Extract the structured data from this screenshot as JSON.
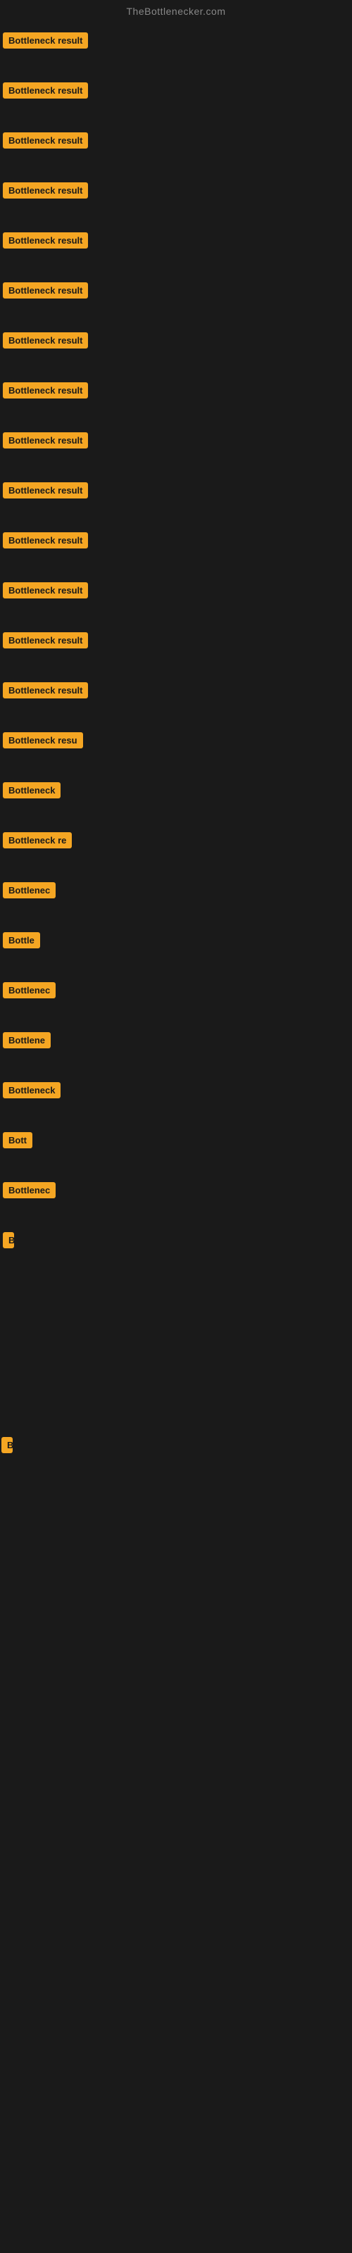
{
  "header": {
    "title": "TheBottlenecker.com"
  },
  "badge_text": "Bottleneck result",
  "items": [
    {
      "id": 0,
      "label": "Bottleneck result"
    },
    {
      "id": 1,
      "label": "Bottleneck result"
    },
    {
      "id": 2,
      "label": "Bottleneck result"
    },
    {
      "id": 3,
      "label": "Bottleneck result"
    },
    {
      "id": 4,
      "label": "Bottleneck result"
    },
    {
      "id": 5,
      "label": "Bottleneck result"
    },
    {
      "id": 6,
      "label": "Bottleneck result"
    },
    {
      "id": 7,
      "label": "Bottleneck result"
    },
    {
      "id": 8,
      "label": "Bottleneck result"
    },
    {
      "id": 9,
      "label": "Bottleneck result"
    },
    {
      "id": 10,
      "label": "Bottleneck result"
    },
    {
      "id": 11,
      "label": "Bottleneck result"
    },
    {
      "id": 12,
      "label": "Bottleneck result"
    },
    {
      "id": 13,
      "label": "Bottleneck result"
    },
    {
      "id": 14,
      "label": "Bottleneck resu"
    },
    {
      "id": 15,
      "label": "Bottleneck"
    },
    {
      "id": 16,
      "label": "Bottleneck re"
    },
    {
      "id": 17,
      "label": "Bottlenec"
    },
    {
      "id": 18,
      "label": "Bottle"
    },
    {
      "id": 19,
      "label": "Bottlenec"
    },
    {
      "id": 20,
      "label": "Bottlene"
    },
    {
      "id": 21,
      "label": "Bottleneck"
    },
    {
      "id": 22,
      "label": "Bott"
    },
    {
      "id": 23,
      "label": "Bottlenec"
    },
    {
      "id": 24,
      "label": "B"
    }
  ],
  "far_item": {
    "label": "B"
  }
}
